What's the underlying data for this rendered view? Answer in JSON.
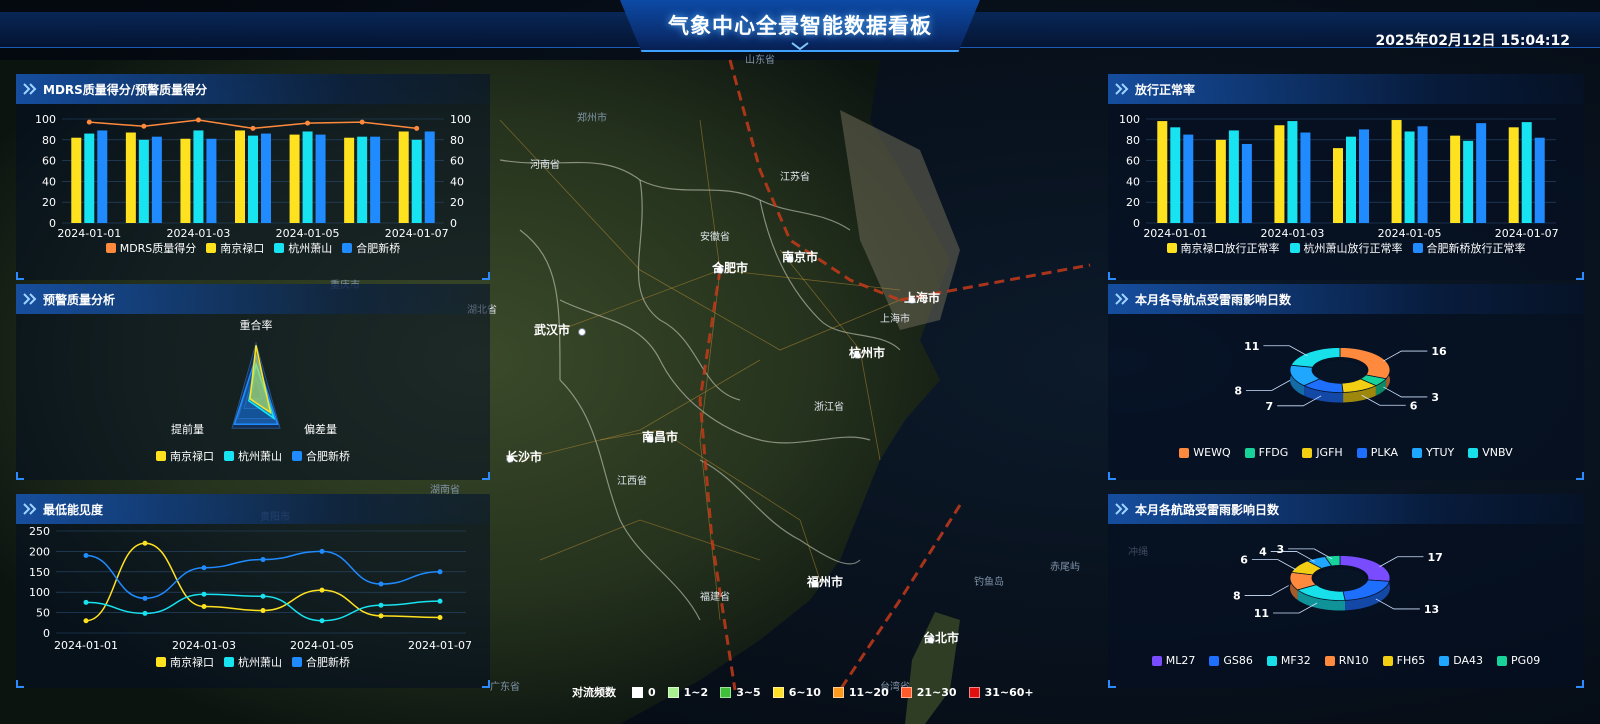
{
  "header": {
    "title": "气象中心全景智能数据看板",
    "datetime": "2025年02月12日 15:04:12"
  },
  "map": {
    "cities": [
      {
        "label": "郑州市",
        "kind": "dim"
      },
      {
        "label": "合肥市",
        "kind": "city"
      },
      {
        "label": "南京市",
        "kind": "city"
      },
      {
        "label": "上海市",
        "kind": "city"
      },
      {
        "label": "上海市",
        "kind": "small"
      },
      {
        "label": "武汉市",
        "kind": "city"
      },
      {
        "label": "杭州市",
        "kind": "city"
      },
      {
        "label": "南昌市",
        "kind": "city"
      },
      {
        "label": "长沙市",
        "kind": "city"
      },
      {
        "label": "福州市",
        "kind": "city"
      },
      {
        "label": "台北市",
        "kind": "city"
      },
      {
        "label": "山东省",
        "kind": "dim"
      },
      {
        "label": "河南省",
        "kind": "small"
      },
      {
        "label": "江苏省",
        "kind": "small"
      },
      {
        "label": "安徽省",
        "kind": "small"
      },
      {
        "label": "湖北省",
        "kind": "small"
      },
      {
        "label": "浙江省",
        "kind": "small"
      },
      {
        "label": "江西省",
        "kind": "small"
      },
      {
        "label": "湖南省",
        "kind": "dim"
      },
      {
        "label": "福建省",
        "kind": "small"
      },
      {
        "label": "台湾省",
        "kind": "dim"
      },
      {
        "label": "广东省",
        "kind": "dim"
      },
      {
        "label": "重庆市",
        "kind": "dim"
      },
      {
        "label": "贵阳市",
        "kind": "dim"
      },
      {
        "label": "冲绳",
        "kind": "dim"
      },
      {
        "label": "赤尾屿",
        "kind": "dim"
      },
      {
        "label": "钓鱼岛",
        "kind": "dim"
      }
    ],
    "legend": {
      "title": "对流频数",
      "items": [
        {
          "label": "0",
          "color": "#ffffff"
        },
        {
          "label": "1~2",
          "color": "#a8f08f"
        },
        {
          "label": "3~5",
          "color": "#3fbf3a"
        },
        {
          "label": "6~10",
          "color": "#ffe02a"
        },
        {
          "label": "11~20",
          "color": "#ff9a1f"
        },
        {
          "label": "21~30",
          "color": "#ff5a2a"
        },
        {
          "label": "31~60+",
          "color": "#e01010"
        }
      ]
    }
  },
  "panels": {
    "mdrs": {
      "title": "MDRS质量得分/预警质量得分",
      "chart_data": {
        "type": "bar",
        "categories": [
          "2024-01-01",
          "2024-01-02",
          "2024-01-03",
          "2024-01-04",
          "2024-01-05",
          "2024-01-06",
          "2024-01-07"
        ],
        "tick_labels": [
          "2024-01-01",
          "2024-01-03",
          "2024-01-05",
          "2024-01-07"
        ],
        "ylim": [
          0,
          100
        ],
        "yticks": [
          "0",
          "20",
          "40",
          "60",
          "80",
          "100"
        ],
        "y2ticks": [
          "0",
          "20",
          "40",
          "60",
          "80",
          "100"
        ],
        "series": [
          {
            "name": "南京禄口",
            "color": "#ffe21f",
            "values": [
              82,
              87,
              81,
              89,
              85,
              82,
              88
            ]
          },
          {
            "name": "杭州萧山",
            "color": "#18e3f0",
            "values": [
              86,
              80,
              89,
              84,
              88,
              83,
              80
            ]
          },
          {
            "name": "合肥新桥",
            "color": "#1f8bff",
            "values": [
              89,
              83,
              81,
              86,
              85,
              83,
              88
            ]
          }
        ],
        "line": {
          "name": "MDRS质量得分",
          "color": "#ff8a3d",
          "values": [
            97,
            93,
            99,
            91,
            96,
            97,
            91
          ]
        },
        "legend": [
          "MDRS质量得分",
          "南京禄口",
          "杭州萧山",
          "合肥新桥"
        ]
      }
    },
    "warn": {
      "title": "预警质量分析",
      "chart_data": {
        "type": "radar",
        "indicators": [
          "重合率",
          "偏差量",
          "提前量"
        ],
        "series": [
          {
            "name": "南京禄口",
            "color": "#ffe21f",
            "values": [
              0.95,
              0.6,
              0.25
            ]
          },
          {
            "name": "杭州萧山",
            "color": "#18e3f0",
            "values": [
              0.55,
              0.75,
              0.3
            ]
          },
          {
            "name": "合肥新桥",
            "color": "#1f8bff",
            "values": [
              0.7,
              0.9,
              0.9
            ]
          }
        ]
      }
    },
    "vis": {
      "title": "最低能见度",
      "chart_data": {
        "type": "line",
        "categories": [
          "2024-01-01",
          "2024-01-02",
          "2024-01-03",
          "2024-01-04",
          "2024-01-05",
          "2024-01-06",
          "2024-01-07"
        ],
        "tick_labels": [
          "2024-01-01",
          "2024-01-03",
          "2024-01-05",
          "2024-01-07"
        ],
        "ylim": [
          0,
          250
        ],
        "yticks": [
          "0",
          "50",
          "100",
          "150",
          "200",
          "250"
        ],
        "series": [
          {
            "name": "南京禄口",
            "color": "#ffe21f",
            "values": [
              30,
              220,
              65,
              55,
              105,
              42,
              38
            ]
          },
          {
            "name": "杭州萧山",
            "color": "#18e3f0",
            "values": [
              75,
              48,
              95,
              90,
              30,
              68,
              78
            ]
          },
          {
            "name": "合肥新桥",
            "color": "#1f8bff",
            "values": [
              190,
              85,
              160,
              180,
              200,
              120,
              150
            ]
          }
        ]
      }
    },
    "release": {
      "title": "放行正常率",
      "chart_data": {
        "type": "bar",
        "categories": [
          "2024-01-01",
          "2024-01-02",
          "2024-01-03",
          "2024-01-04",
          "2024-01-05",
          "2024-01-06",
          "2024-01-07"
        ],
        "tick_labels": [
          "2024-01-01",
          "2024-01-03",
          "2024-01-05",
          "2024-01-07"
        ],
        "ylim": [
          0,
          100
        ],
        "yticks": [
          "0",
          "20",
          "40",
          "60",
          "80",
          "100"
        ],
        "series": [
          {
            "name": "南京禄口放行正常率",
            "color": "#ffe21f",
            "values": [
              98,
              80,
              94,
              72,
              99,
              84,
              92
            ]
          },
          {
            "name": "杭州萧山放行正常率",
            "color": "#18e3f0",
            "values": [
              92,
              89,
              98,
              83,
              88,
              79,
              97
            ]
          },
          {
            "name": "合肥新桥放行正常率",
            "color": "#1f8bff",
            "values": [
              85,
              76,
              87,
              90,
              93,
              96,
              82
            ]
          }
        ]
      }
    },
    "navpoints": {
      "title": "本月各导航点受雷雨影响日数",
      "chart_data": {
        "type": "pie",
        "labels": [
          "WEWQ",
          "FFDG",
          "JGFH",
          "PLKA",
          "YTUY",
          "VNBV"
        ],
        "colors": [
          "#ff8a3d",
          "#17d39a",
          "#f2cf12",
          "#1f6fff",
          "#1fa6ff",
          "#17e0ea"
        ],
        "values": [
          16,
          3,
          6,
          7,
          8,
          11
        ]
      }
    },
    "routes": {
      "title": "本月各航路受雷雨影响日数",
      "chart_data": {
        "type": "pie",
        "labels": [
          "ML27",
          "GS86",
          "MF32",
          "RN10",
          "FH65",
          "DA43",
          "PG09"
        ],
        "colors": [
          "#7a4cff",
          "#1f6fff",
          "#17e0ea",
          "#ff8a3d",
          "#f2cf12",
          "#1fa6ff",
          "#17d39a"
        ],
        "values": [
          17,
          13,
          11,
          8,
          6,
          4,
          3
        ]
      }
    }
  }
}
